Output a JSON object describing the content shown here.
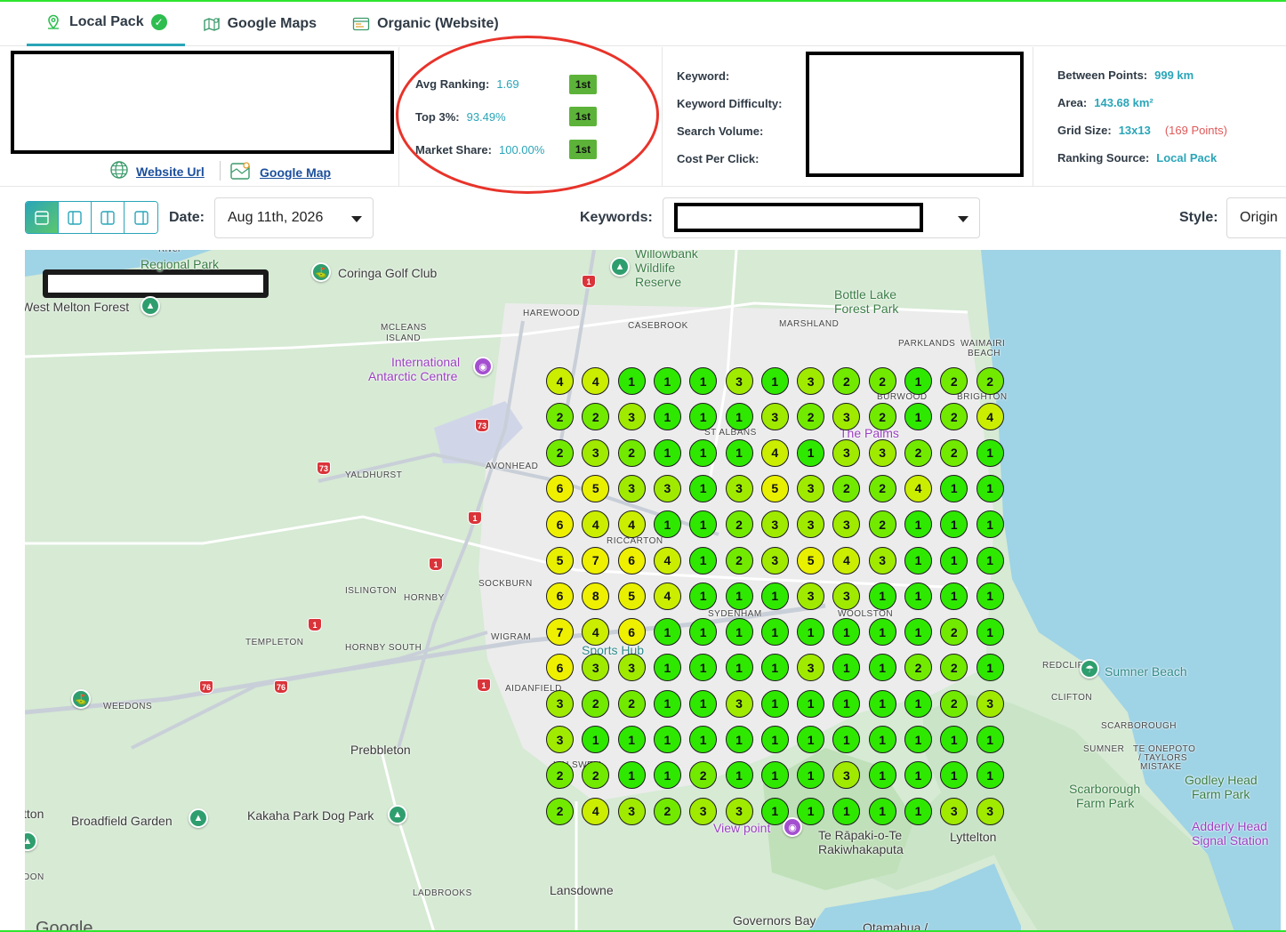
{
  "tabs": [
    {
      "label": "Local Pack",
      "icon": "location-pin-icon",
      "active": true,
      "badge": "check-circle-icon"
    },
    {
      "label": "Google Maps",
      "icon": "map-icon",
      "active": false
    },
    {
      "label": "Organic (Website)",
      "icon": "browser-icon",
      "active": false
    }
  ],
  "business": {
    "website_label": "Website Url",
    "map_label": "Google Map"
  },
  "stats": {
    "avg_ranking_label": "Avg Ranking:",
    "avg_ranking_value": "1.69",
    "avg_ranking_badge": "1st",
    "top3_label": "Top 3%:",
    "top3_value": "93.49%",
    "top3_badge": "1st",
    "market_share_label": "Market Share:",
    "market_share_value": "100.00%",
    "market_share_badge": "1st"
  },
  "keyword_info": {
    "keyword_label": "Keyword:",
    "difficulty_label": "Keyword Difficulty:",
    "volume_label": "Search Volume:",
    "cpc_label": "Cost Per Click:"
  },
  "grid_meta": {
    "between_label": "Between Points:",
    "between_value": "999 km",
    "area_label": "Area:",
    "area_value": "143.68 km²",
    "grid_label": "Grid Size:",
    "grid_value": "13x13",
    "grid_points": "(169 Points)",
    "source_label": "Ranking Source:",
    "source_value": "Local Pack"
  },
  "toolbar": {
    "date_label": "Date:",
    "date_value": "Aug 11th, 2026",
    "keywords_label": "Keywords:",
    "style_label": "Style:",
    "style_value": "Origin"
  },
  "map": {
    "places": [
      {
        "t": "River",
        "c": "small"
      },
      {
        "t": "Regional Park",
        "c": "poi-g"
      },
      {
        "t": "Coringa Golf Club",
        "c": ""
      },
      {
        "t": "Willowbank",
        "c": "poi-g"
      },
      {
        "t": "Wildlife",
        "c": "poi-g"
      },
      {
        "t": "Reserve",
        "c": "poi-g"
      },
      {
        "t": "Bottle Lake",
        "c": "poi-g"
      },
      {
        "t": "Forest Park",
        "c": "poi-g"
      },
      {
        "t": "West Melton Forest",
        "c": ""
      },
      {
        "t": "HAREWOOD",
        "c": "small"
      },
      {
        "t": "CASEBROOK",
        "c": "small"
      },
      {
        "t": "MARSHLAND",
        "c": "small"
      },
      {
        "t": "MCLEANS",
        "c": "small"
      },
      {
        "t": "ISLAND",
        "c": "small"
      },
      {
        "t": "PARKLANDS",
        "c": "small"
      },
      {
        "t": "WAIMAIRI",
        "c": "small"
      },
      {
        "t": "BEACH",
        "c": "small"
      },
      {
        "t": "International",
        "c": "poi-p"
      },
      {
        "t": "Antarctic Centre",
        "c": "poi-p"
      },
      {
        "t": "YALDHURST",
        "c": "small"
      },
      {
        "t": "AVONHEAD",
        "c": "small"
      },
      {
        "t": "ISLINGTON",
        "c": "small"
      },
      {
        "t": "HORNBY",
        "c": "small"
      },
      {
        "t": "SOCKBURN",
        "c": "small"
      },
      {
        "t": "TEMPLETON",
        "c": "small"
      },
      {
        "t": "HORNBY SOUTH",
        "c": "small"
      },
      {
        "t": "WIGRAM",
        "c": "small"
      },
      {
        "t": "AIDANFIELD",
        "c": "small"
      },
      {
        "t": "WEEDONS",
        "c": "small"
      },
      {
        "t": "Prebbleton",
        "c": ""
      },
      {
        "t": "HALSWELL",
        "c": "small"
      },
      {
        "t": "Broadfield Garden",
        "c": ""
      },
      {
        "t": "Kakaha Park Dog Park",
        "c": ""
      },
      {
        "t": "LADBROOKS",
        "c": "small"
      },
      {
        "t": "Lansdowne",
        "c": ""
      },
      {
        "t": "Governors Bay",
        "c": ""
      },
      {
        "t": "Te Rāpaki-o-Te",
        "c": ""
      },
      {
        "t": "Rakiwhakaputa",
        "c": ""
      },
      {
        "t": "Lyttelton",
        "c": ""
      },
      {
        "t": "Sumner Beach",
        "c": "poi-t"
      },
      {
        "t": "CLIFTON",
        "c": "small"
      },
      {
        "t": "SCARBOROUGH",
        "c": "small"
      },
      {
        "t": "SUMNER",
        "c": "small"
      },
      {
        "t": "TE ONEPOTO",
        "c": "small"
      },
      {
        "t": "/ TAYLORS",
        "c": "small"
      },
      {
        "t": "MISTAKE",
        "c": "small"
      },
      {
        "t": "Scarborough",
        "c": "poi-g"
      },
      {
        "t": "Farm Park",
        "c": "poi-g"
      },
      {
        "t": "Godley Head",
        "c": "poi-g"
      },
      {
        "t": "Farm Park",
        "c": "poi-g"
      },
      {
        "t": "Adderly Head",
        "c": "poi-p"
      },
      {
        "t": "Signal Station",
        "c": "poi-p"
      },
      {
        "t": "REDCLIFFS",
        "c": "small"
      },
      {
        "t": "Sports Hub",
        "c": "poi-t"
      },
      {
        "t": "View point",
        "c": "poi-p"
      },
      {
        "t": "RICCARTON",
        "c": "small"
      },
      {
        "t": "SYDENHAM",
        "c": "small"
      },
      {
        "t": "WOOLSTON",
        "c": "small"
      },
      {
        "t": "ST ALBANS",
        "c": "small"
      },
      {
        "t": "The Palms",
        "c": "poi-p"
      },
      {
        "t": "BURWOOD",
        "c": "small"
      },
      {
        "t": "BRIGHTON",
        "c": "small"
      },
      {
        "t": "tton",
        "c": ""
      },
      {
        "t": "DON",
        "c": "small"
      },
      {
        "t": "Otamahua /",
        "c": ""
      }
    ],
    "shields": [
      "1",
      "73",
      "73",
      "1",
      "1",
      "1",
      "76",
      "76",
      "1"
    ],
    "pins": [
      {
        "icon": "golf-icon",
        "color": "#2e9e6e"
      },
      {
        "icon": "tree-icon",
        "color": "#2e9e6e"
      },
      {
        "icon": "tree-icon",
        "color": "#2e9e6e"
      },
      {
        "icon": "camera-icon",
        "color": "#a44fd0"
      },
      {
        "icon": "golf-icon",
        "color": "#2e9e6e"
      },
      {
        "icon": "tree-icon",
        "color": "#2e9e6e"
      },
      {
        "icon": "tree-icon",
        "color": "#2e9e6e"
      },
      {
        "icon": "beach-icon",
        "color": "#2e9e6e"
      },
      {
        "icon": "camera-icon",
        "color": "#a44fd0"
      },
      {
        "icon": "tree-icon",
        "color": "#2e9e6e"
      }
    ],
    "attribution": "Google"
  },
  "rank_colors": {
    "1": "#2fe800",
    "2": "#72ea00",
    "3": "#a0ea00",
    "4": "#cbee00",
    "5": "#e8f000",
    "6": "#eef000",
    "7": "#eef000",
    "8": "#eef000"
  },
  "rank_grid": [
    [
      4,
      4,
      1,
      1,
      1,
      3,
      1,
      3,
      2,
      2,
      1,
      2,
      2
    ],
    [
      2,
      2,
      3,
      1,
      1,
      1,
      3,
      2,
      3,
      2,
      1,
      2,
      4
    ],
    [
      2,
      3,
      2,
      1,
      1,
      1,
      4,
      1,
      3,
      3,
      2,
      2,
      1
    ],
    [
      6,
      5,
      3,
      3,
      1,
      3,
      5,
      3,
      2,
      2,
      4,
      1,
      1
    ],
    [
      6,
      4,
      4,
      1,
      1,
      2,
      3,
      3,
      3,
      2,
      1,
      1,
      1
    ],
    [
      5,
      7,
      6,
      4,
      1,
      2,
      3,
      5,
      4,
      3,
      1,
      1,
      1
    ],
    [
      6,
      8,
      5,
      4,
      1,
      1,
      1,
      3,
      3,
      1,
      1,
      1,
      1
    ],
    [
      7,
      4,
      6,
      1,
      1,
      1,
      1,
      1,
      1,
      1,
      1,
      2,
      1
    ],
    [
      6,
      3,
      3,
      1,
      1,
      1,
      1,
      3,
      1,
      1,
      2,
      2,
      1
    ],
    [
      3,
      2,
      2,
      1,
      1,
      3,
      1,
      1,
      1,
      1,
      1,
      2,
      3
    ],
    [
      3,
      1,
      1,
      1,
      1,
      1,
      1,
      1,
      1,
      1,
      1,
      1,
      1
    ],
    [
      2,
      2,
      1,
      1,
      2,
      1,
      1,
      1,
      3,
      1,
      1,
      1,
      1
    ],
    [
      2,
      4,
      3,
      2,
      3,
      3,
      1,
      1,
      1,
      1,
      1,
      3,
      3
    ]
  ]
}
